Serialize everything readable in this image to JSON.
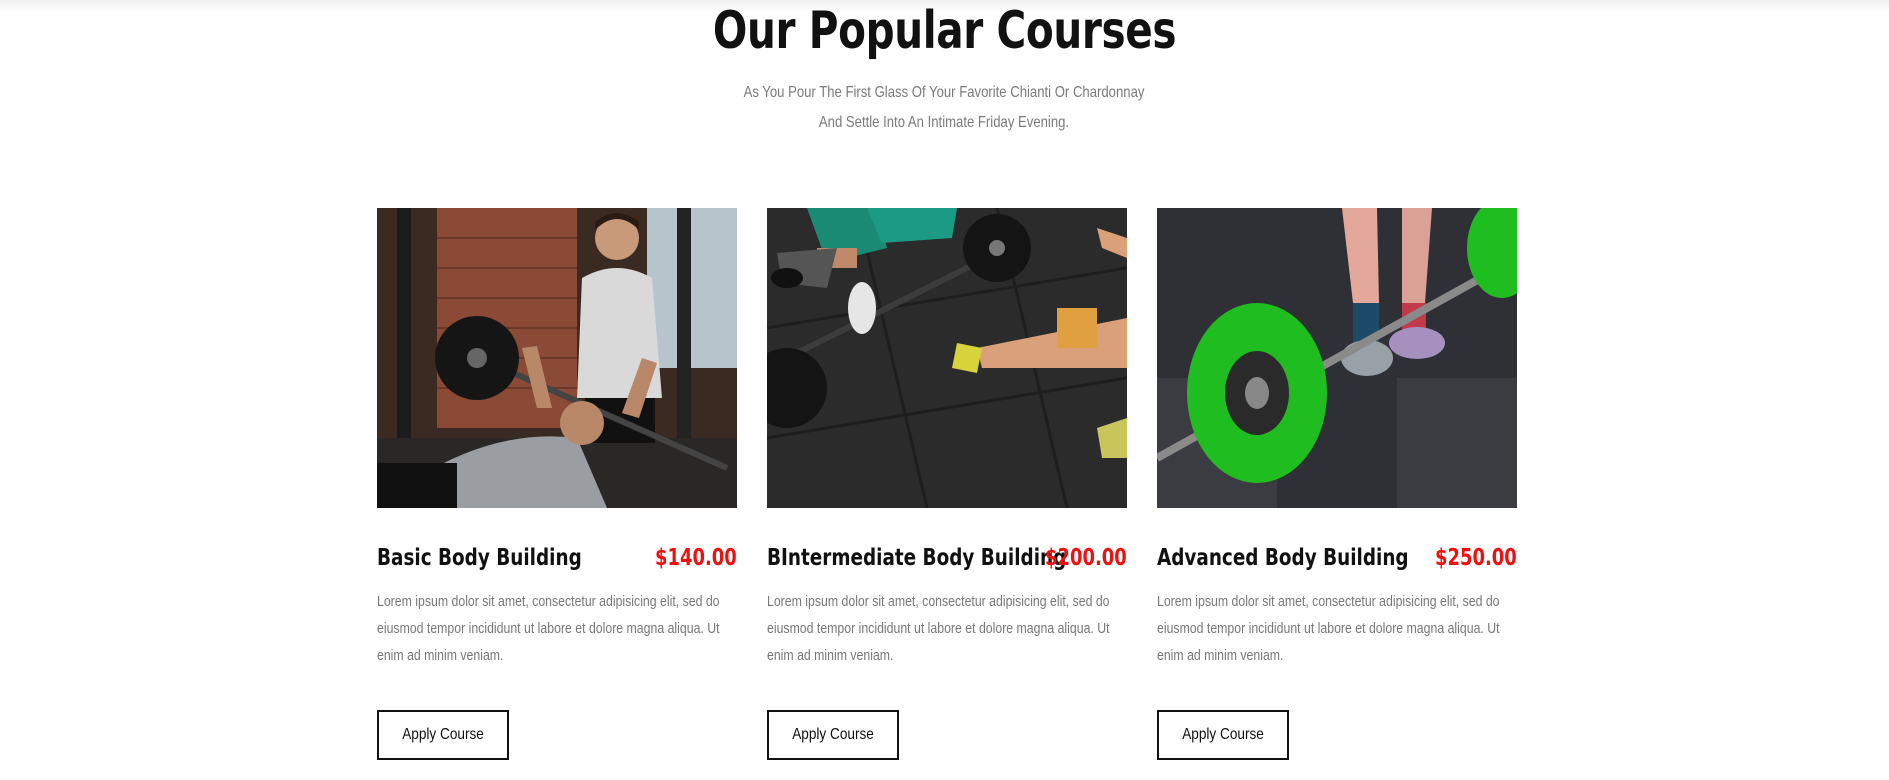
{
  "section": {
    "title": "Our Popular Courses",
    "subtitle": "As You Pour The First Glass Of Your Favorite Chianti Or Chardonnay And Settle Into An Intimate Friday Evening."
  },
  "colors": {
    "price": "#ee1111",
    "title": "#111111",
    "text_muted": "#777777",
    "plate_green": "#1fbd1f"
  },
  "courses": [
    {
      "title": "Basic Body Building",
      "price": "$140.00",
      "description": "Lorem ipsum dolor sit amet, consectetur adipisicing elit, sed do eiusmod tempor incididunt ut labore et dolore magna aliqua. Ut enim ad minim veniam.",
      "button_label": "Apply Course",
      "image": "bench-press-photo"
    },
    {
      "title": "BIntermediate Body Building",
      "price": "$200.00",
      "description": "Lorem ipsum dolor sit amet, consectetur adipisicing elit, sed do eiusmod tempor incididunt ut labore et dolore magna aliqua. Ut enim ad minim veniam.",
      "button_label": "Apply Course",
      "image": "floor-barbell-photo"
    },
    {
      "title": "Advanced Body Building",
      "price": "$250.00",
      "description": "Lorem ipsum dolor sit amet, consectetur adipisicing elit, sed do eiusmod tempor incididunt ut labore et dolore magna aliqua. Ut enim ad minim veniam.",
      "button_label": "Apply Course",
      "image": "green-plate-barbell-photo"
    }
  ]
}
